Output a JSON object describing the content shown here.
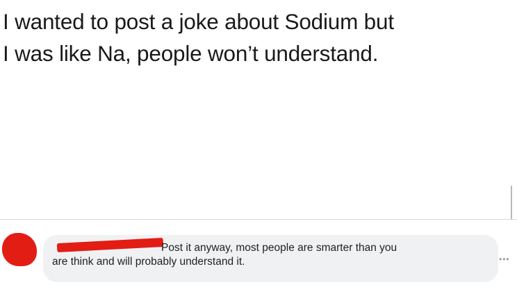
{
  "post": {
    "lines": [
      "I wanted to post a joke about Sodium but",
      "I was like Na, people won’t understand."
    ]
  },
  "comment": {
    "lines": [
      "Post it anyway, most people are smarter than you",
      "are think and will probably understand it."
    ],
    "more_icon": "more-options-icon",
    "redaction_color": "#e21d14"
  }
}
